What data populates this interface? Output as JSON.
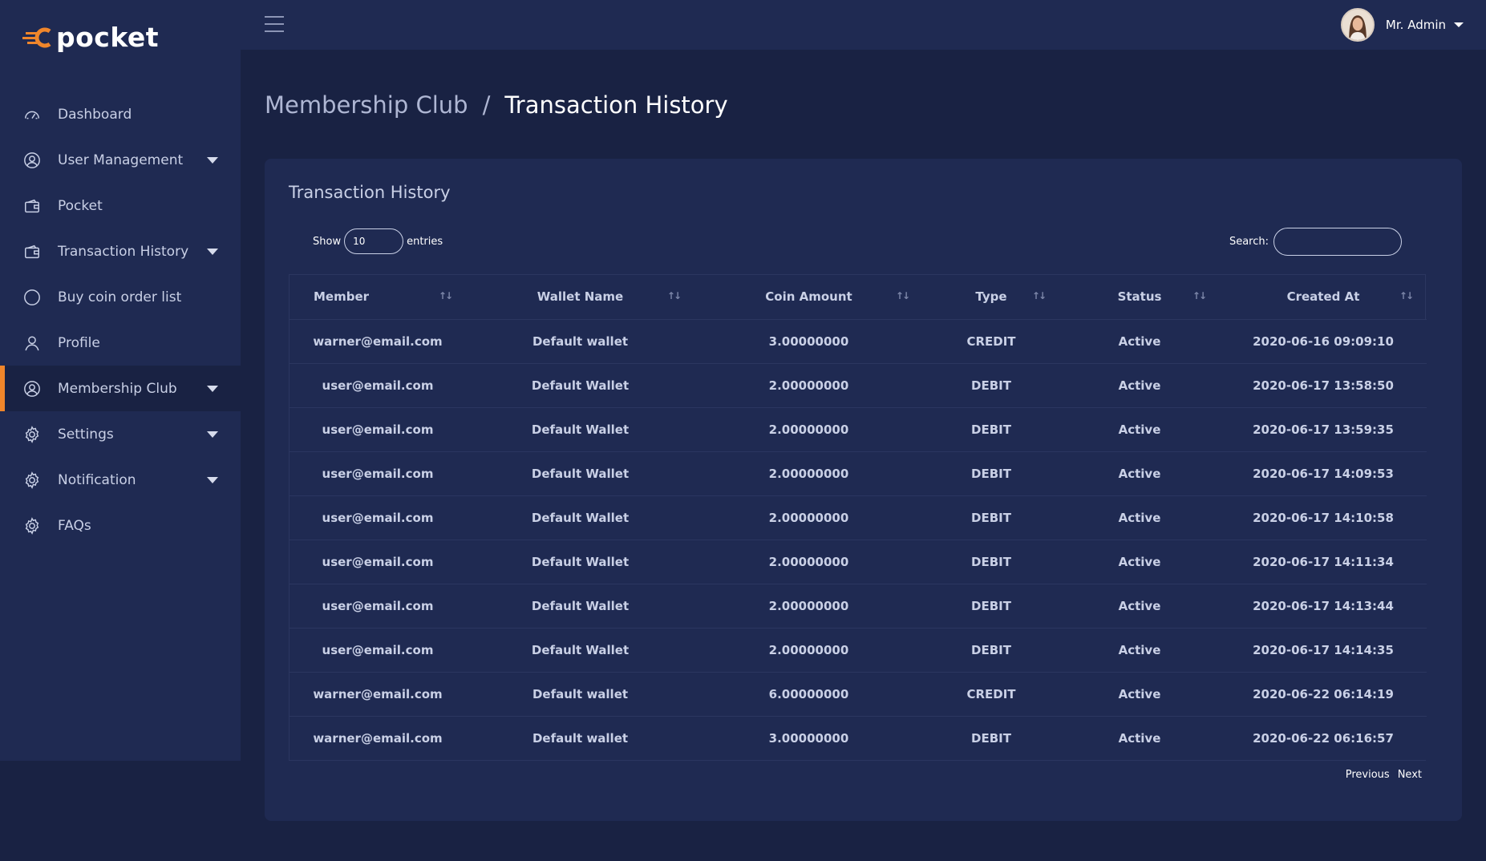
{
  "brand": {
    "name": "pocket",
    "accent": "#f0862b"
  },
  "sidebar": {
    "items": [
      {
        "label": "Dashboard",
        "icon": "dashboard-icon",
        "dropdown": false,
        "active": false
      },
      {
        "label": "User Management",
        "icon": "user-circle-icon",
        "dropdown": true,
        "active": false
      },
      {
        "label": "Pocket",
        "icon": "wallet-icon",
        "dropdown": false,
        "active": false
      },
      {
        "label": "Transaction History",
        "icon": "wallet-icon",
        "dropdown": true,
        "active": false
      },
      {
        "label": "Buy coin order list",
        "icon": "circle-icon",
        "dropdown": false,
        "active": false
      },
      {
        "label": "Profile",
        "icon": "user-icon",
        "dropdown": false,
        "active": false
      },
      {
        "label": "Membership Club",
        "icon": "user-circle-icon",
        "dropdown": true,
        "active": true
      },
      {
        "label": "Settings",
        "icon": "gear-icon",
        "dropdown": true,
        "active": false
      },
      {
        "label": "Notification",
        "icon": "gear-icon",
        "dropdown": true,
        "active": false
      },
      {
        "label": "FAQs",
        "icon": "gear-icon",
        "dropdown": false,
        "active": false
      }
    ]
  },
  "topbar": {
    "user_name": "Mr. Admin"
  },
  "breadcrumb": {
    "parent": "Membership Club",
    "separator": "/",
    "current": "Transaction History"
  },
  "card": {
    "title": "Transaction History",
    "length": {
      "show_label": "Show",
      "value": "10",
      "entries_label": "entries"
    },
    "search": {
      "label": "Search:",
      "value": ""
    }
  },
  "table": {
    "columns": [
      "Member",
      "Wallet Name",
      "Coin Amount",
      "Type",
      "Status",
      "Created At"
    ],
    "rows": [
      [
        "warner@email.com",
        "Default wallet",
        "3.00000000",
        "CREDIT",
        "Active",
        "2020-06-16 09:09:10"
      ],
      [
        "user@email.com",
        "Default Wallet",
        "2.00000000",
        "DEBIT",
        "Active",
        "2020-06-17 13:58:50"
      ],
      [
        "user@email.com",
        "Default Wallet",
        "2.00000000",
        "DEBIT",
        "Active",
        "2020-06-17 13:59:35"
      ],
      [
        "user@email.com",
        "Default Wallet",
        "2.00000000",
        "DEBIT",
        "Active",
        "2020-06-17 14:09:53"
      ],
      [
        "user@email.com",
        "Default Wallet",
        "2.00000000",
        "DEBIT",
        "Active",
        "2020-06-17 14:10:58"
      ],
      [
        "user@email.com",
        "Default Wallet",
        "2.00000000",
        "DEBIT",
        "Active",
        "2020-06-17 14:11:34"
      ],
      [
        "user@email.com",
        "Default Wallet",
        "2.00000000",
        "DEBIT",
        "Active",
        "2020-06-17 14:13:44"
      ],
      [
        "user@email.com",
        "Default Wallet",
        "2.00000000",
        "DEBIT",
        "Active",
        "2020-06-17 14:14:35"
      ],
      [
        "warner@email.com",
        "Default wallet",
        "6.00000000",
        "CREDIT",
        "Active",
        "2020-06-22 06:14:19"
      ],
      [
        "warner@email.com",
        "Default wallet",
        "3.00000000",
        "DEBIT",
        "Active",
        "2020-06-22 06:16:57"
      ]
    ]
  },
  "pagination": {
    "previous": "Previous",
    "next": "Next"
  }
}
